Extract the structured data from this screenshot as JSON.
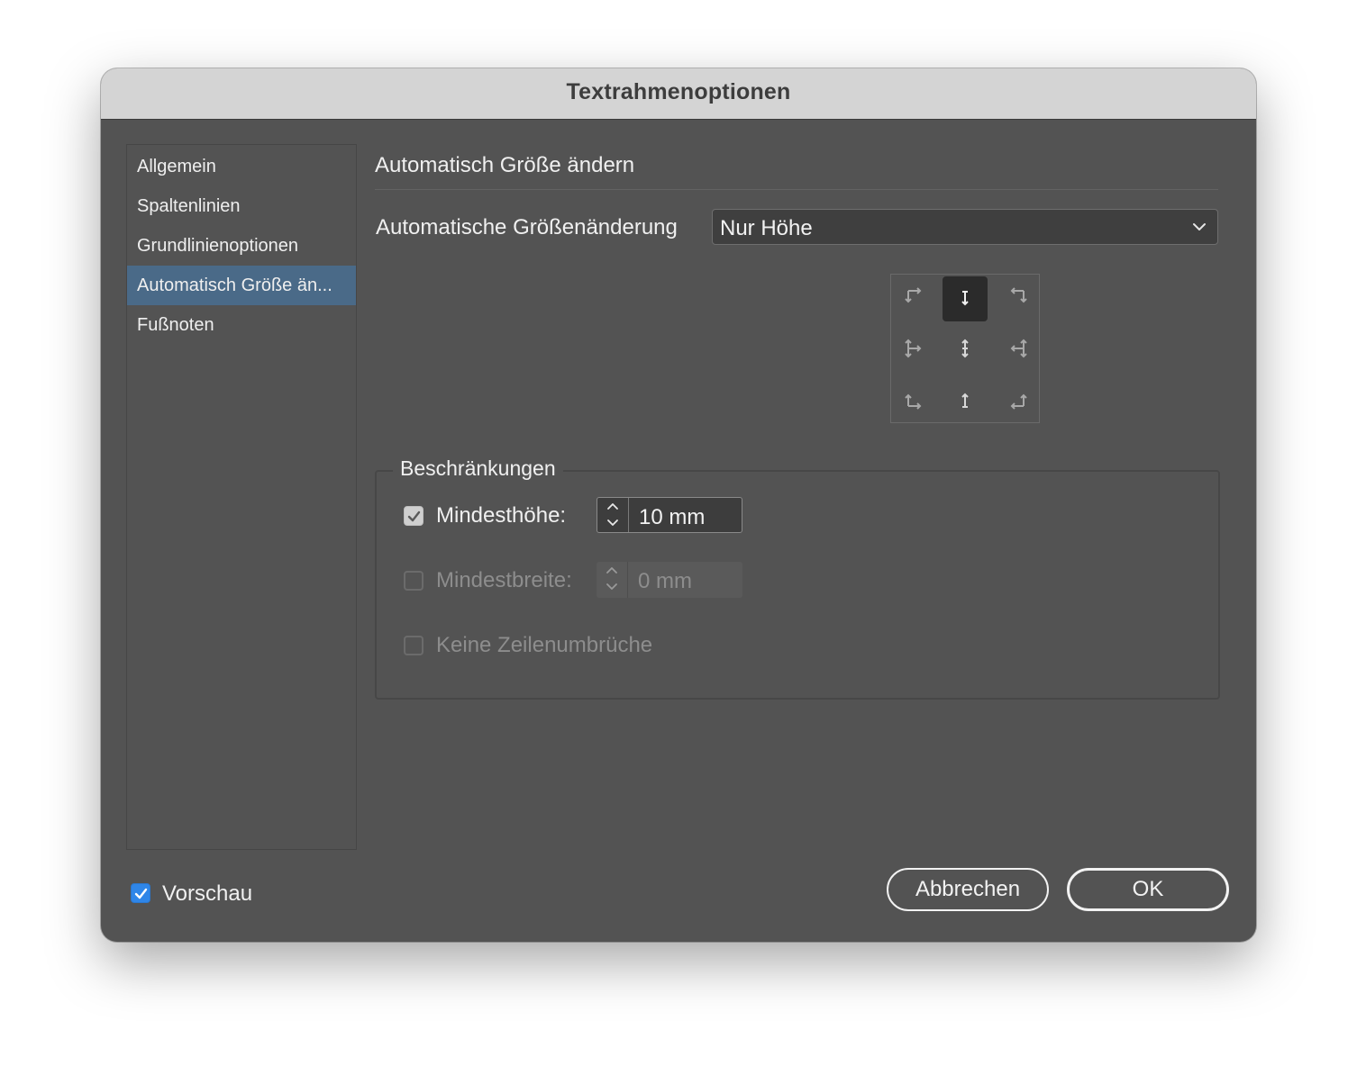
{
  "window": {
    "title": "Textrahmenoptionen"
  },
  "sidebar": {
    "items": [
      {
        "label": "Allgemein"
      },
      {
        "label": "Spaltenlinien"
      },
      {
        "label": "Grundlinienoptionen"
      },
      {
        "label": "Automatisch Größe än..."
      },
      {
        "label": "Fußnoten"
      }
    ],
    "selected_index": 3
  },
  "panel": {
    "heading": "Automatisch Größe ändern",
    "auto_resize": {
      "label": "Automatische Größenänderung",
      "selected_value": "Nur Höhe"
    },
    "anchor_grid": {
      "selected": "top-center",
      "cells": [
        {
          "name": "top-left",
          "icon": "arrow-down-right-icon"
        },
        {
          "name": "top-center",
          "icon": "arrow-down-icon"
        },
        {
          "name": "top-right",
          "icon": "arrow-down-left-icon"
        },
        {
          "name": "middle-left",
          "icon": "arrow-vertical-right-icon"
        },
        {
          "name": "middle-center",
          "icon": "arrow-vertical-icon"
        },
        {
          "name": "middle-right",
          "icon": "arrow-vertical-left-icon"
        },
        {
          "name": "bottom-left",
          "icon": "arrow-up-right-icon"
        },
        {
          "name": "bottom-center",
          "icon": "arrow-up-icon"
        },
        {
          "name": "bottom-right",
          "icon": "arrow-up-left-icon"
        }
      ]
    },
    "constraints": {
      "title": "Beschränkungen",
      "min_height": {
        "label": "Mindesthöhe:",
        "checked": true,
        "enabled": true,
        "value": "10 mm"
      },
      "min_width": {
        "label": "Mindestbreite:",
        "checked": false,
        "enabled": false,
        "value": "0 mm"
      },
      "no_line_breaks": {
        "label": "Keine Zeilenumbrüche",
        "checked": false,
        "enabled": false
      }
    }
  },
  "footer": {
    "preview": {
      "label": "Vorschau",
      "checked": true
    },
    "cancel_label": "Abbrechen",
    "ok_label": "OK"
  },
  "colors": {
    "dialog_bg": "#535353",
    "titlebar_bg": "#d4d4d4",
    "selection": "#4a6a88",
    "checkbox_accent": "#2f86e8"
  }
}
